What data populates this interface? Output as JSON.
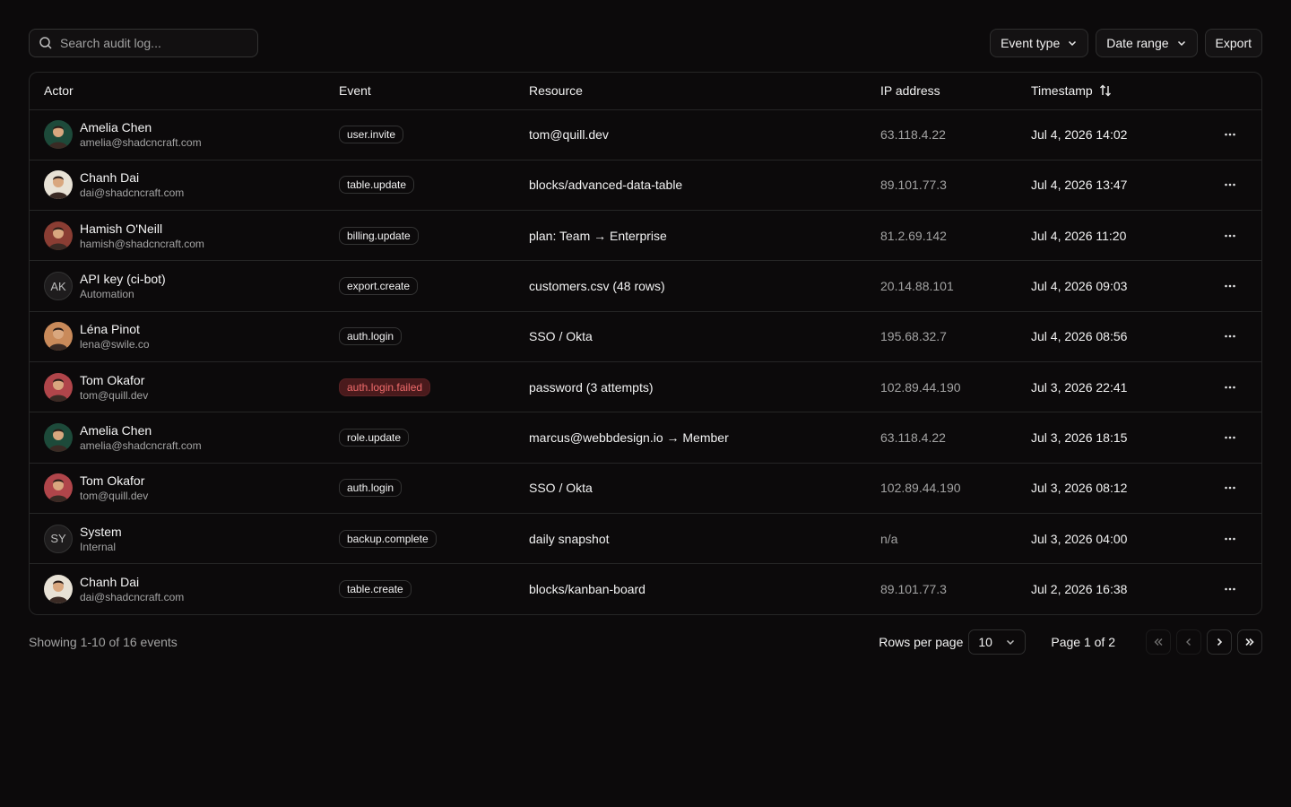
{
  "search": {
    "placeholder": "Search audit log..."
  },
  "toolbar": {
    "event_type_label": "Event type",
    "date_range_label": "Date range",
    "export_label": "Export"
  },
  "table": {
    "headers": {
      "actor": "Actor",
      "event": "Event",
      "resource": "Resource",
      "ip": "IP address",
      "timestamp": "Timestamp"
    },
    "rows": [
      {
        "name": "Amelia Chen",
        "sub": "amelia@shadcncraft.com",
        "avatar": "photo",
        "avatar_color": "#1d4a3a",
        "event": "user.invite",
        "event_style": "default",
        "resource": "tom@quill.dev",
        "ip": "63.118.4.22",
        "timestamp": "Jul 4, 2026 14:02"
      },
      {
        "name": "Chanh Dai",
        "sub": "dai@shadcncraft.com",
        "avatar": "photo",
        "avatar_color": "#e8e2d6",
        "event": "table.update",
        "event_style": "default",
        "resource": "blocks/advanced-data-table",
        "ip": "89.101.77.3",
        "timestamp": "Jul 4, 2026 13:47"
      },
      {
        "name": "Hamish O'Neill",
        "sub": "hamish@shadcncraft.com",
        "avatar": "photo",
        "avatar_color": "#8a3d33",
        "event": "billing.update",
        "event_style": "default",
        "resource": "plan: Team → Enterprise",
        "ip": "81.2.69.142",
        "timestamp": "Jul 4, 2026 11:20"
      },
      {
        "name": "API key (ci-bot)",
        "sub": "Automation",
        "avatar": "AK",
        "avatar_color": "",
        "event": "export.create",
        "event_style": "default",
        "resource": "customers.csv (48 rows)",
        "ip": "20.14.88.101",
        "timestamp": "Jul 4, 2026 09:03"
      },
      {
        "name": "Léna Pinot",
        "sub": "lena@swile.co",
        "avatar": "photo",
        "avatar_color": "#c98a5a",
        "event": "auth.login",
        "event_style": "default",
        "resource": "SSO / Okta",
        "ip": "195.68.32.7",
        "timestamp": "Jul 4, 2026 08:56"
      },
      {
        "name": "Tom Okafor",
        "sub": "tom@quill.dev",
        "avatar": "photo",
        "avatar_color": "#b0454a",
        "event": "auth.login.failed",
        "event_style": "danger",
        "resource": "password (3 attempts)",
        "ip": "102.89.44.190",
        "timestamp": "Jul 3, 2026 22:41"
      },
      {
        "name": "Amelia Chen",
        "sub": "amelia@shadcncraft.com",
        "avatar": "photo",
        "avatar_color": "#1d4a3a",
        "event": "role.update",
        "event_style": "default",
        "resource": "marcus@webbdesign.io → Member",
        "ip": "63.118.4.22",
        "timestamp": "Jul 3, 2026 18:15"
      },
      {
        "name": "Tom Okafor",
        "sub": "tom@quill.dev",
        "avatar": "photo",
        "avatar_color": "#b0454a",
        "event": "auth.login",
        "event_style": "default",
        "resource": "SSO / Okta",
        "ip": "102.89.44.190",
        "timestamp": "Jul 3, 2026 08:12"
      },
      {
        "name": "System",
        "sub": "Internal",
        "avatar": "SY",
        "avatar_color": "",
        "event": "backup.complete",
        "event_style": "default",
        "resource": "daily snapshot",
        "ip": "n/a",
        "timestamp": "Jul 3, 2026 04:00"
      },
      {
        "name": "Chanh Dai",
        "sub": "dai@shadcncraft.com",
        "avatar": "photo",
        "avatar_color": "#e8e2d6",
        "event": "table.create",
        "event_style": "default",
        "resource": "blocks/kanban-board",
        "ip": "89.101.77.3",
        "timestamp": "Jul 2, 2026 16:38"
      }
    ]
  },
  "footer": {
    "showing": "Showing 1-10 of 16 events",
    "rows_per_page_label": "Rows per page",
    "rows_per_page_value": "10",
    "page_info": "Page 1 of 2"
  }
}
